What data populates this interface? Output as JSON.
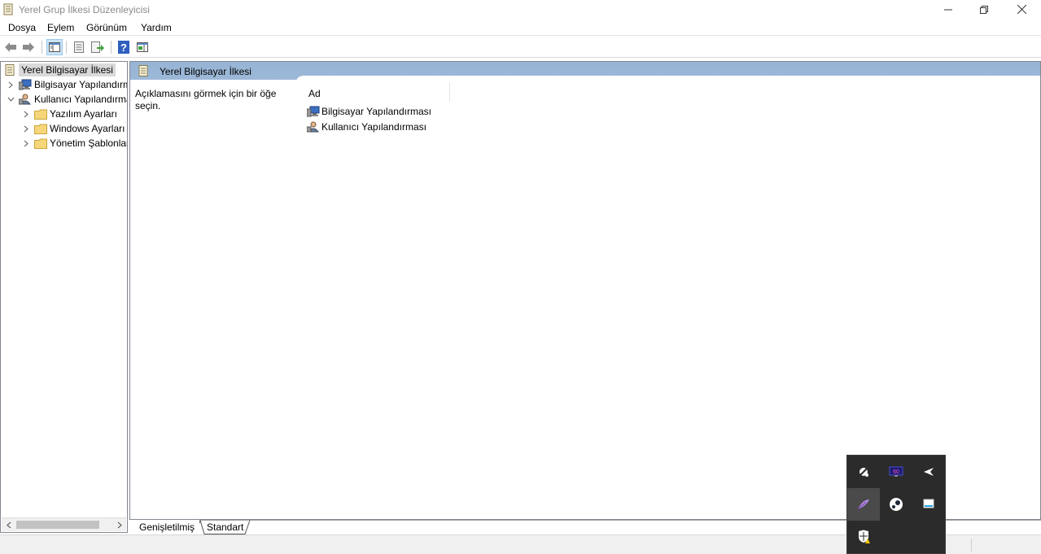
{
  "window": {
    "title": "Yerel Grup İlkesi Düzenleyicisi"
  },
  "menu": {
    "items": [
      "Dosya",
      "Eylem",
      "Görünüm",
      "Yardım"
    ]
  },
  "toolbar": {
    "buttons": [
      "back-icon",
      "forward-icon",
      "show-hide-tree-icon",
      "properties-icon",
      "export-list-icon",
      "help-icon",
      "show-action-pane-icon"
    ]
  },
  "tree": {
    "root": "Yerel Bilgisayar İlkesi",
    "items": [
      {
        "label": "Bilgisayar Yapılandırması",
        "expanded": false
      },
      {
        "label": "Kullanıcı Yapılandırması",
        "expanded": true
      },
      {
        "label": "Yazılım Ayarları",
        "expanded": false
      },
      {
        "label": "Windows Ayarları",
        "expanded": false
      },
      {
        "label": "Yönetim Şablonları",
        "expanded": false
      }
    ]
  },
  "right": {
    "header": "Yerel Bilgisayar İlkesi",
    "description": "Açıklamasını görmek için bir öğe seçin.",
    "column_header": "Ad",
    "items": [
      "Bilgisayar Yapılandırması",
      "Kullanıcı Yapılandırması"
    ]
  },
  "bottom_tabs": [
    "Genişletilmiş",
    "Standart"
  ],
  "tray": {
    "icons": [
      "satellite-icon",
      "gpu-monitor-icon",
      "airplane-icon",
      "feather-icon",
      "steam-icon",
      "display-icon",
      "security-shield-warning-icon"
    ]
  },
  "colors": {
    "header_blue": "#9ab6d6",
    "tray_bg": "#2b2b2b",
    "selected_tab": "#cce4f7"
  }
}
